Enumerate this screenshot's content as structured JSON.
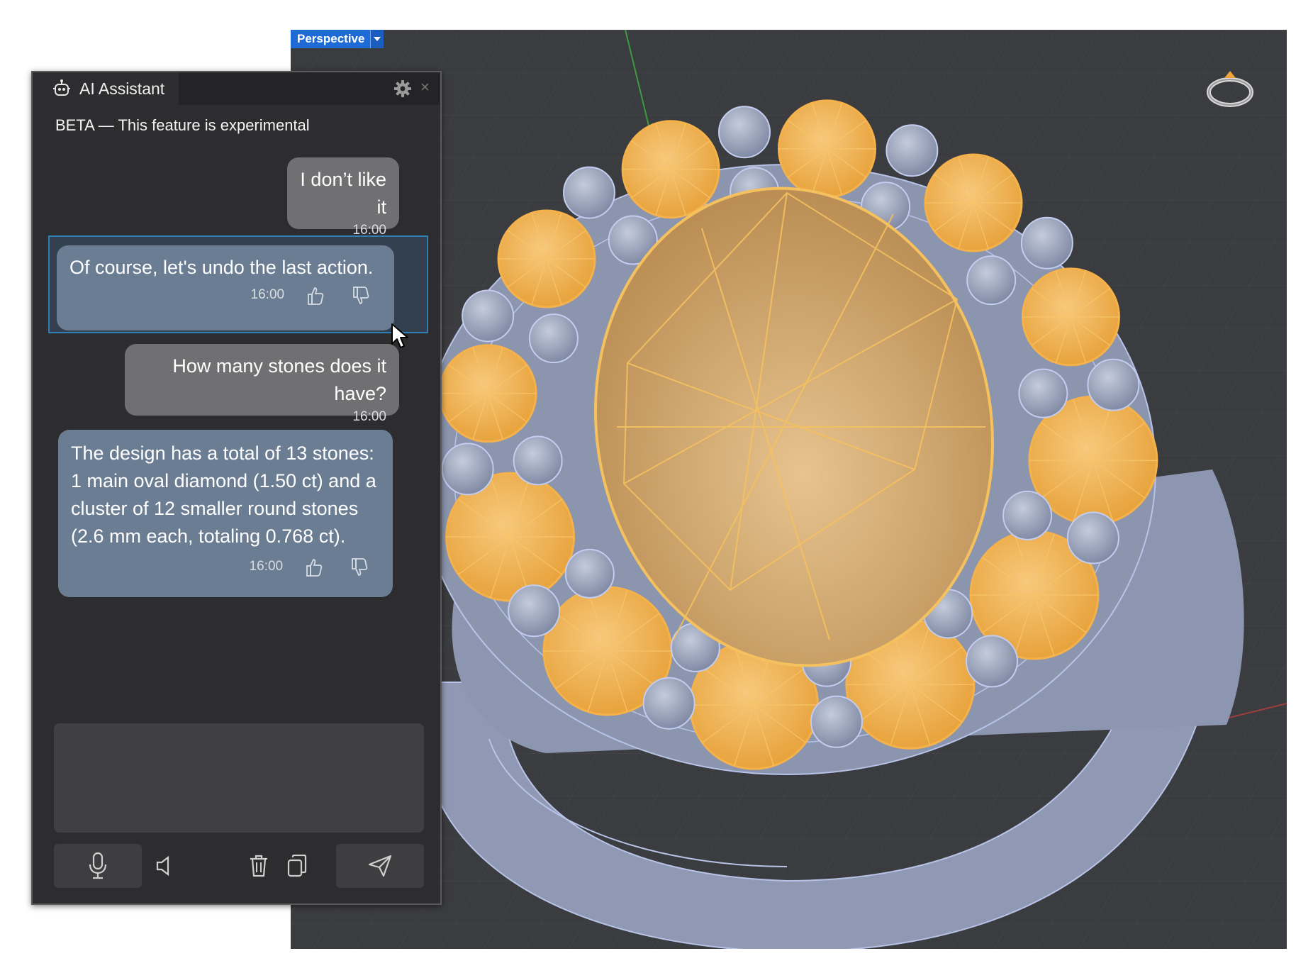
{
  "viewport": {
    "label": "Perspective",
    "colors": {
      "background": "#3b3c3f",
      "metal": "#9aa4bd",
      "stone": "#f5b24b",
      "label_bg": "#1e6bd6"
    }
  },
  "panel": {
    "title": "AI Assistant",
    "beta_note": "BETA — This feature is experimental",
    "messages": [
      {
        "role": "user",
        "text": "I don’t like it",
        "time": "16:00"
      },
      {
        "role": "assistant",
        "text": "Of course, let's undo the last action.",
        "time": "16:00"
      },
      {
        "role": "user",
        "text": "How many stones does it have?",
        "time": "16:00"
      },
      {
        "role": "assistant",
        "text": "The design has a total of 13 stones: 1 main oval diamond (1.50 ct) and a cluster of 12 smaller round stones (2.6 mm each, totaling 0.768 ct).",
        "time": "16:00"
      }
    ],
    "input": {
      "value": ""
    },
    "toolbar": [
      "microphone-icon",
      "speaker-icon",
      "trash-icon",
      "copy-icon",
      "send-icon"
    ]
  }
}
